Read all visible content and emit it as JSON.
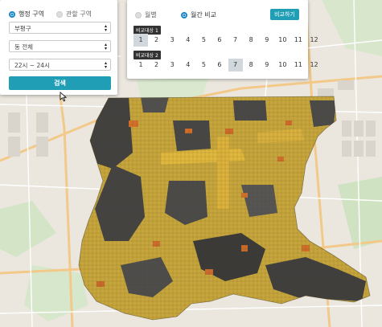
{
  "left_panel": {
    "radio_admin": "행정 구역",
    "radio_jurisdiction": "관할 구역",
    "district_select": "부평구",
    "dong_select": "동 전체",
    "time_select": "22시 ~ 24시",
    "search_button": "검색"
  },
  "right_panel": {
    "radio_monthly": "월별",
    "radio_monthly_compare": "월간 비교",
    "compare_button": "비교하기",
    "compare_target_1": "비교대상 1",
    "compare_target_2": "비교대상 2",
    "months_row1": [
      "1",
      "2",
      "3",
      "4",
      "5",
      "6",
      "7",
      "8",
      "9",
      "10",
      "11",
      "12"
    ],
    "months_row2": [
      "1",
      "2",
      "3",
      "4",
      "5",
      "6",
      "7",
      "8",
      "9",
      "10",
      "11",
      "12"
    ],
    "row1_selected": "1",
    "row2_selected": "7"
  },
  "colors": {
    "accent": "#1f9eb5",
    "radio_selected": "#1a87c8",
    "heat_low": "#3d3d3d",
    "heat_mid": "#c9a83a",
    "heat_high": "#d6702c"
  }
}
